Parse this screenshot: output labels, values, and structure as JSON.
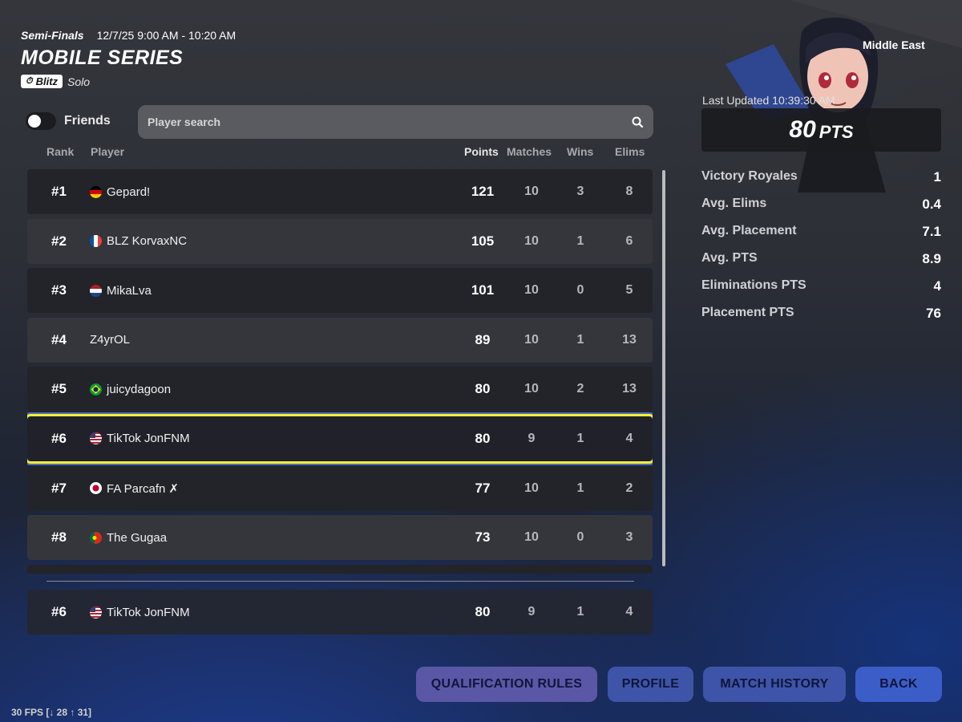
{
  "event": {
    "stage": "Semi-Finals",
    "datetime": "12/7/25 9:00 AM - 10:20 AM",
    "title": "MOBILE SERIES",
    "mode_badge": "Blitz",
    "mode_type": "Solo"
  },
  "filters": {
    "friends_label": "Friends",
    "friends_on": false,
    "search_placeholder": "Player search"
  },
  "columns": {
    "rank": "Rank",
    "player": "Player",
    "points": "Points",
    "matches": "Matches",
    "wins": "Wins",
    "elims": "Elims"
  },
  "leaderboard": [
    {
      "rank": "#1",
      "name": "Gepard!",
      "flag": "de",
      "points": "121",
      "matches": "10",
      "wins": "3",
      "elims": "8"
    },
    {
      "rank": "#2",
      "name": "BLZ KorvaxNC",
      "flag": "fr",
      "points": "105",
      "matches": "10",
      "wins": "1",
      "elims": "6"
    },
    {
      "rank": "#3",
      "name": "MikaLva",
      "flag": "nl",
      "points": "101",
      "matches": "10",
      "wins": "0",
      "elims": "5"
    },
    {
      "rank": "#4",
      "name": "Z4yrOL",
      "flag": "",
      "points": "89",
      "matches": "10",
      "wins": "1",
      "elims": "13"
    },
    {
      "rank": "#5",
      "name": "juicydagoon",
      "flag": "br",
      "points": "80",
      "matches": "10",
      "wins": "2",
      "elims": "13"
    },
    {
      "rank": "#6",
      "name": "TikTok JonFNM",
      "flag": "us",
      "points": "80",
      "matches": "9",
      "wins": "1",
      "elims": "4",
      "self": true
    },
    {
      "rank": "#7",
      "name": "FA Parcafn ✗",
      "flag": "jp",
      "points": "77",
      "matches": "10",
      "wins": "1",
      "elims": "2"
    },
    {
      "rank": "#8",
      "name": "The Gugaa",
      "flag": "pt",
      "points": "73",
      "matches": "10",
      "wins": "0",
      "elims": "3"
    }
  ],
  "pinned": {
    "rank": "#6",
    "name": "TikTok JonFNM",
    "flag": "us",
    "points": "80",
    "matches": "9",
    "wins": "1",
    "elims": "4"
  },
  "profile": {
    "region": "Middle East",
    "last_updated": "Last Updated 10:39:30 AM",
    "points_value": "80",
    "points_unit": "PTS",
    "stats": [
      {
        "label": "Victory Royales",
        "value": "1"
      },
      {
        "label": "Avg. Elims",
        "value": "0.4"
      },
      {
        "label": "Avg. Placement",
        "value": "7.1"
      },
      {
        "label": "Avg. PTS",
        "value": "8.9"
      },
      {
        "label": "Eliminations PTS",
        "value": "4"
      },
      {
        "label": "Placement PTS",
        "value": "76"
      }
    ]
  },
  "buttons": {
    "qualification": "QUALIFICATION RULES",
    "profile": "PROFILE",
    "history": "MATCH HISTORY",
    "back": "BACK"
  },
  "fps": "30 FPS [↓ 28 ↑ 31]",
  "icons": {
    "search": "search-icon",
    "badge": "blitz-badge-icon",
    "portrait": "character-portrait"
  }
}
